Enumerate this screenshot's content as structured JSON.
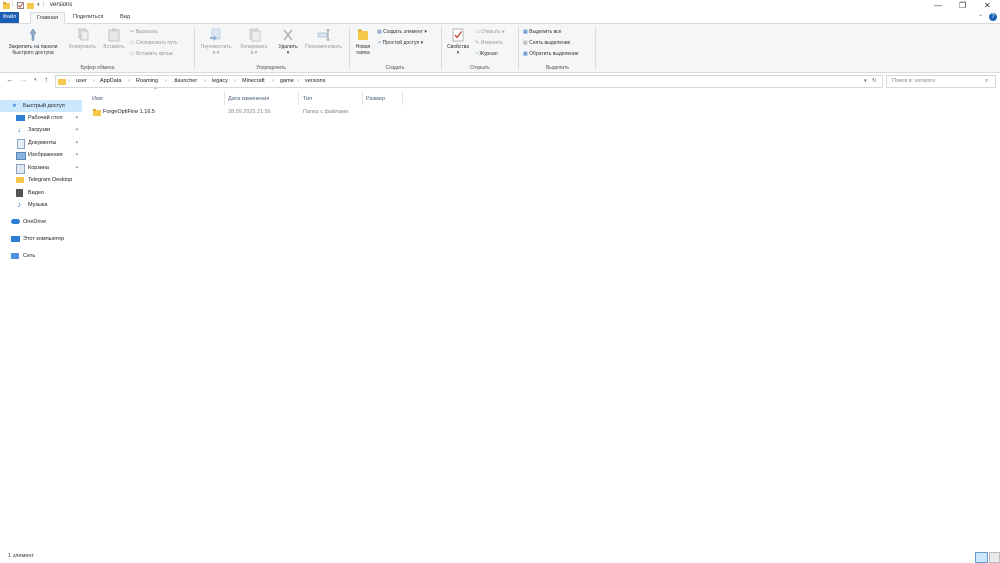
{
  "window": {
    "title": "versions",
    "controls": {
      "minimize": "—",
      "maximize": "❐",
      "close": "✕"
    }
  },
  "ribbon_tabs": [
    "Файл",
    "Главная",
    "Поделиться",
    "Вид"
  ],
  "ribbon": {
    "clipboard": {
      "pin_label_1": "Закрепить на панели",
      "pin_label_2": "быстрого доступа",
      "copy": "Копировать",
      "paste": "Вставить",
      "cut": "Вырезать",
      "copy_path": "Скопировать путь",
      "paste_shortcut": "Вставить ярлык",
      "group": "Буфер обмена"
    },
    "organize": {
      "move_1": "Переместить",
      "move_2": "в ▾",
      "copy_1": "Копировать",
      "copy_2": "в ▾",
      "delete": "Удалить",
      "delete_arrow": "▾",
      "rename": "Переименовать",
      "group": "Упорядочить"
    },
    "create": {
      "new_folder_1": "Новая",
      "new_folder_2": "папка",
      "new_item": "Создать элемент ▾",
      "easy_access": "Простой доступ ▾",
      "group": "Создать"
    },
    "open": {
      "properties": "Свойства",
      "properties_arrow": "▾",
      "open": "Открыть ▾",
      "edit": "Изменить",
      "history": "Журнал",
      "group": "Открыть"
    },
    "select": {
      "select_all": "Выделить все",
      "select_none": "Снять выделение",
      "invert": "Обратить выделение",
      "group": "Выделить"
    }
  },
  "address": {
    "crumbs": [
      "user",
      "AppData",
      "Roaming",
      ".tlauncher",
      "legacy",
      "Minecraft",
      "game",
      "versions"
    ],
    "search_placeholder": "Поиск в: versions"
  },
  "nav": {
    "items": [
      {
        "label": "Быстрый доступ",
        "icon": "star-icon",
        "pinned": false,
        "selected": true
      },
      {
        "label": "Рабочий стол",
        "icon": "desktop-icon",
        "pinned": true
      },
      {
        "label": "Загрузки",
        "icon": "download-icon",
        "pinned": true
      },
      {
        "label": "Документы",
        "icon": "documents-icon",
        "pinned": true
      },
      {
        "label": "Изображения",
        "icon": "pictures-icon",
        "pinned": true
      },
      {
        "label": "Корзина",
        "icon": "recycle-bin-icon",
        "pinned": true
      },
      {
        "label": "Telegram Desktop",
        "icon": "folder-icon",
        "pinned": false
      },
      {
        "label": "Видео",
        "icon": "video-icon",
        "pinned": false
      },
      {
        "label": "Музыка",
        "icon": "music-icon",
        "pinned": false
      },
      {
        "label": "OneDrive",
        "icon": "cloud-icon",
        "pinned": false
      },
      {
        "label": "Этот компьютер",
        "icon": "computer-icon",
        "pinned": false
      },
      {
        "label": "Сеть",
        "icon": "network-icon",
        "pinned": false
      }
    ]
  },
  "columns": {
    "name": "Имя",
    "date": "Дата изменения",
    "type": "Тип",
    "size": "Размер"
  },
  "files": [
    {
      "name": "ForgeOptiFine 1.16.5",
      "date": "28.09.2025 21:56",
      "type": "Папка с файлами",
      "size": ""
    }
  ],
  "status": {
    "count": "1 элемент"
  },
  "colors": {
    "accent": "#1a5fb4",
    "selection": "#cce8ff",
    "folder": "#f5c84c"
  }
}
